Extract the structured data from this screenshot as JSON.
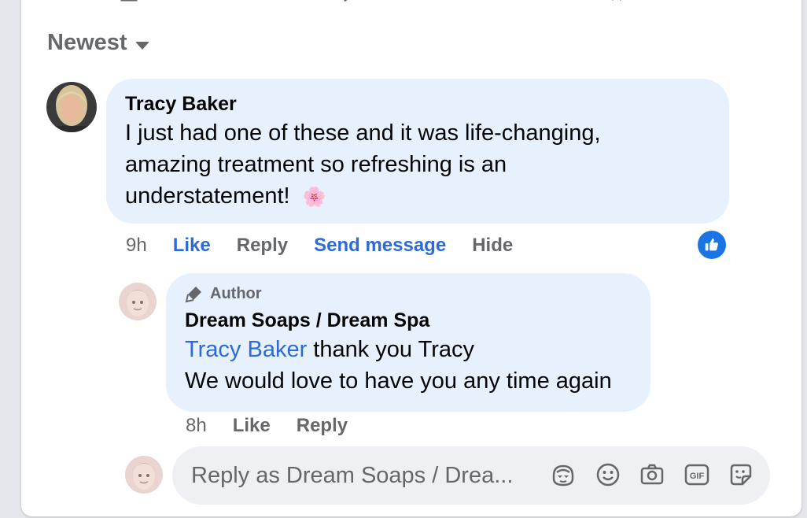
{
  "sort": {
    "label": "Newest"
  },
  "comment": {
    "author": "Tracy Baker",
    "text_lines": [
      "I just had one of these and it was life-changing,",
      "amazing treatment so refreshing is an",
      "understatement!"
    ],
    "emoji": "🌸",
    "time": "9h",
    "like_label": "Like",
    "reply_label": "Reply",
    "send_message_label": "Send message",
    "hide_label": "Hide",
    "reaction_icon": "thumbs-up-icon"
  },
  "reply": {
    "badge": "Author",
    "author": "Dream Soaps / Dream Spa",
    "mention": "Tracy Baker",
    "line1_rest": " thank you Tracy",
    "line2": "We would love to have you any time again",
    "time": "8h",
    "like_label": "Like",
    "reply_label": "Reply"
  },
  "composer": {
    "placeholder": "Reply as Dream Soaps / Drea..."
  },
  "colors": {
    "accent": "#2d6ad7",
    "bubble": "#e7f1fd",
    "muted": "#65676b"
  }
}
